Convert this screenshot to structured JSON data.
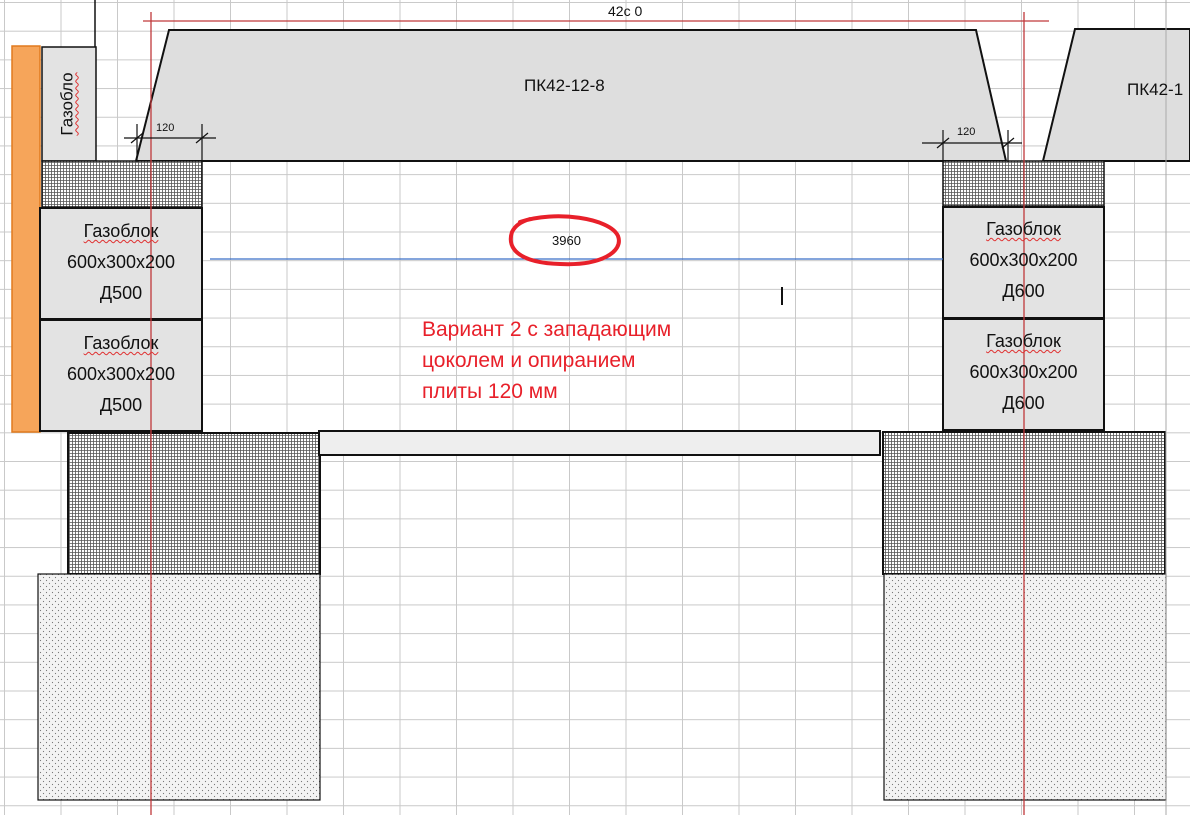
{
  "top_dimension": "42с 0",
  "slab_main_label": "ПК42-12-8",
  "slab_right_label": "ПК42-1",
  "left_partial_label": "Газобло",
  "support_left_dim": "120",
  "support_right_dim": "120",
  "span_dim": "3960",
  "blocks_left": [
    {
      "line1": "Газоблок",
      "line2": "600x300x200",
      "line3": "Д500"
    },
    {
      "line1": "Газоблок",
      "line2": "600x300x200",
      "line3": "Д500"
    }
  ],
  "blocks_right": [
    {
      "line1": "Газоблок",
      "line2": "600x300x200",
      "line3": "Д600"
    },
    {
      "line1": "Газоблок",
      "line2": "600x300x200",
      "line3": "Д600"
    }
  ],
  "note": {
    "line1": "Вариант 2 с западающим",
    "line2": "цоколем и опиранием",
    "line3": "плиты 120 мм"
  },
  "colors": {
    "axis_red": "#c0393b",
    "slab_fill": "#dedede",
    "block_fill": "#e3e3e3",
    "annotation_red": "#e8202a",
    "span_line_blue": "#3a6fc8",
    "insulation_orange": "#f6a55a"
  }
}
